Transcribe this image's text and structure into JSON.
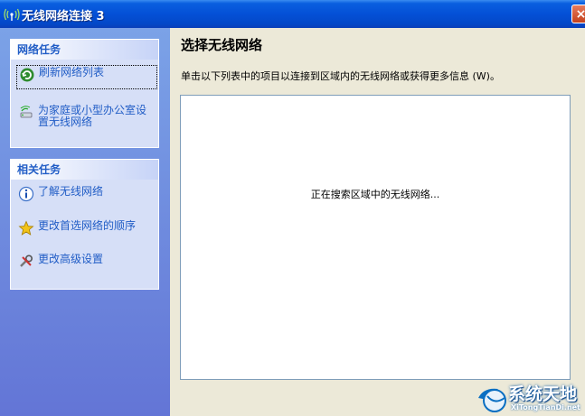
{
  "window": {
    "title": "无线网络连接 3",
    "close_label": "×"
  },
  "sidebar": {
    "network_tasks": {
      "header": "网络任务",
      "items": [
        {
          "label": "刷新网络列表",
          "icon": "refresh-icon"
        },
        {
          "label": "为家庭或小型办公室设置无线网络",
          "icon": "network-setup-icon"
        }
      ]
    },
    "related_tasks": {
      "header": "相关任务",
      "items": [
        {
          "label": "了解无线网络",
          "icon": "info-icon"
        },
        {
          "label": "更改首选网络的顺序",
          "icon": "star-icon"
        },
        {
          "label": "更改高级设置",
          "icon": "advanced-settings-icon"
        }
      ]
    }
  },
  "main": {
    "heading": "选择无线网络",
    "description": "单击以下列表中的项目以连接到区域内的无线网络或获得更多信息 (W)。",
    "status": "正在搜索区域中的无线网络..."
  },
  "watermark": {
    "main": "系统天地",
    "sub": "XiTongTianDi.net"
  },
  "colors": {
    "titlebar": "#0450d6",
    "sidebar": "#7ba2e7",
    "task_link": "#215dc6",
    "panel": "#d6dff7"
  }
}
